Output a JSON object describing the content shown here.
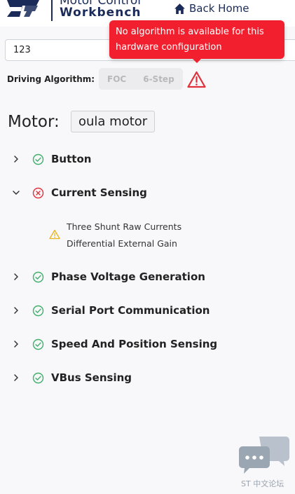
{
  "header": {
    "title_line1": "Motor Control",
    "title_line2": "Workbench",
    "back_home": "Back Home"
  },
  "search": {
    "value": "123"
  },
  "tooltip": {
    "message": "No algorithm is available for this hardware configuration"
  },
  "driving": {
    "label": "Driving Algorithm:",
    "options": [
      "FOC",
      "6-Step"
    ]
  },
  "motor": {
    "label": "Motor:",
    "name": "oula motor"
  },
  "tree": [
    {
      "label": "Button",
      "status": "ok",
      "expanded": false
    },
    {
      "label": "Current Sensing",
      "status": "error",
      "expanded": true
    },
    {
      "label": "Phase Voltage Generation",
      "status": "ok",
      "expanded": false
    },
    {
      "label": "Serial Port Communication",
      "status": "ok",
      "expanded": false
    },
    {
      "label": "Speed And Position Sensing",
      "status": "ok",
      "expanded": false
    },
    {
      "label": "VBus Sensing",
      "status": "ok",
      "expanded": false
    }
  ],
  "current_sensing_details": {
    "status": "warning",
    "lines": [
      "Three Shunt Raw Currents",
      "Differential External Gain"
    ]
  },
  "forum": {
    "label": "ST 中文论坛"
  },
  "colors": {
    "brand_navy": "#1a2b5a",
    "tooltip_red": "#f2202f",
    "ok_green": "#3fae6a",
    "error_red": "#e0303a",
    "warning_amber": "#e8b21a"
  }
}
